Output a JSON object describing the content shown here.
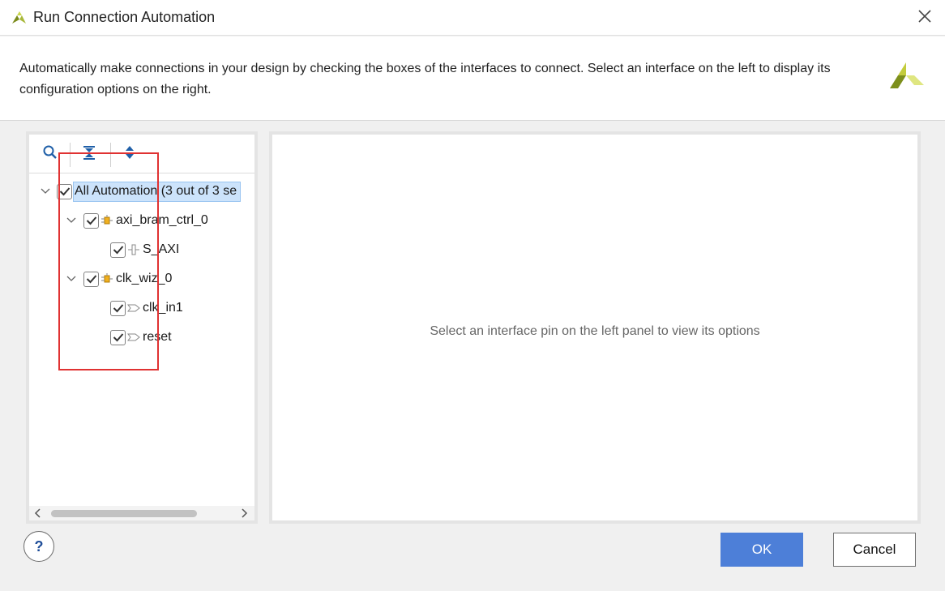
{
  "window": {
    "title": "Run Connection Automation",
    "app_icon": "vivado-logo-icon",
    "close_icon": "close-icon"
  },
  "description": "Automatically make connections in your design by checking the boxes of the interfaces to connect. Select an interface on the left to display its configuration options on the right.",
  "toolbar": {
    "search_icon": "search-icon",
    "collapse_all_icon": "collapse-all-icon",
    "expand_all_icon": "expand-all-icon"
  },
  "tree": {
    "root": {
      "label": "All Automation (3 out of 3 se",
      "checked": true,
      "expanded": true
    },
    "items": [
      {
        "label": "axi_bram_ctrl_0",
        "checked": true,
        "expanded": true,
        "icon": "ip-block-icon",
        "children": [
          {
            "label": "S_AXI",
            "checked": true,
            "icon": "bus-interface-icon"
          }
        ]
      },
      {
        "label": "clk_wiz_0",
        "checked": true,
        "expanded": true,
        "icon": "ip-block-icon",
        "children": [
          {
            "label": "clk_in1",
            "checked": true,
            "icon": "pin-icon"
          },
          {
            "label": "reset",
            "checked": true,
            "icon": "pin-icon"
          }
        ]
      }
    ]
  },
  "right_panel": {
    "message": "Select an interface pin on the left panel to view its options"
  },
  "buttons": {
    "help": "?",
    "ok": "OK",
    "cancel": "Cancel"
  },
  "colors": {
    "ok_button": "#4d7fd8",
    "highlight_box": "#e03232",
    "selection": "#cce3fb"
  }
}
